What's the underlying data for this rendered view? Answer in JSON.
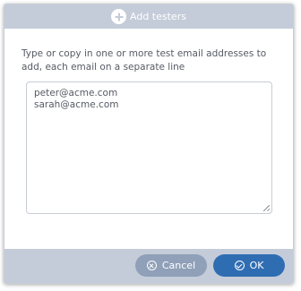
{
  "dialog": {
    "title": "Add testers",
    "instructions": "Type or copy in one or more test email addresses to add, each email on a separate line",
    "emails": [
      "peter@acme.com",
      "sarah@acme.com"
    ],
    "buttons": {
      "cancel_label": "Cancel",
      "ok_label": "OK"
    }
  },
  "icons": {
    "header": "plus-circle-icon",
    "cancel": "x-circle-icon",
    "ok": "check-circle-icon"
  },
  "colors": {
    "header_bg": "#c4ccd9",
    "cancel_bg": "#8fa0b8",
    "ok_bg": "#2f6db3",
    "text": "#555a63"
  }
}
